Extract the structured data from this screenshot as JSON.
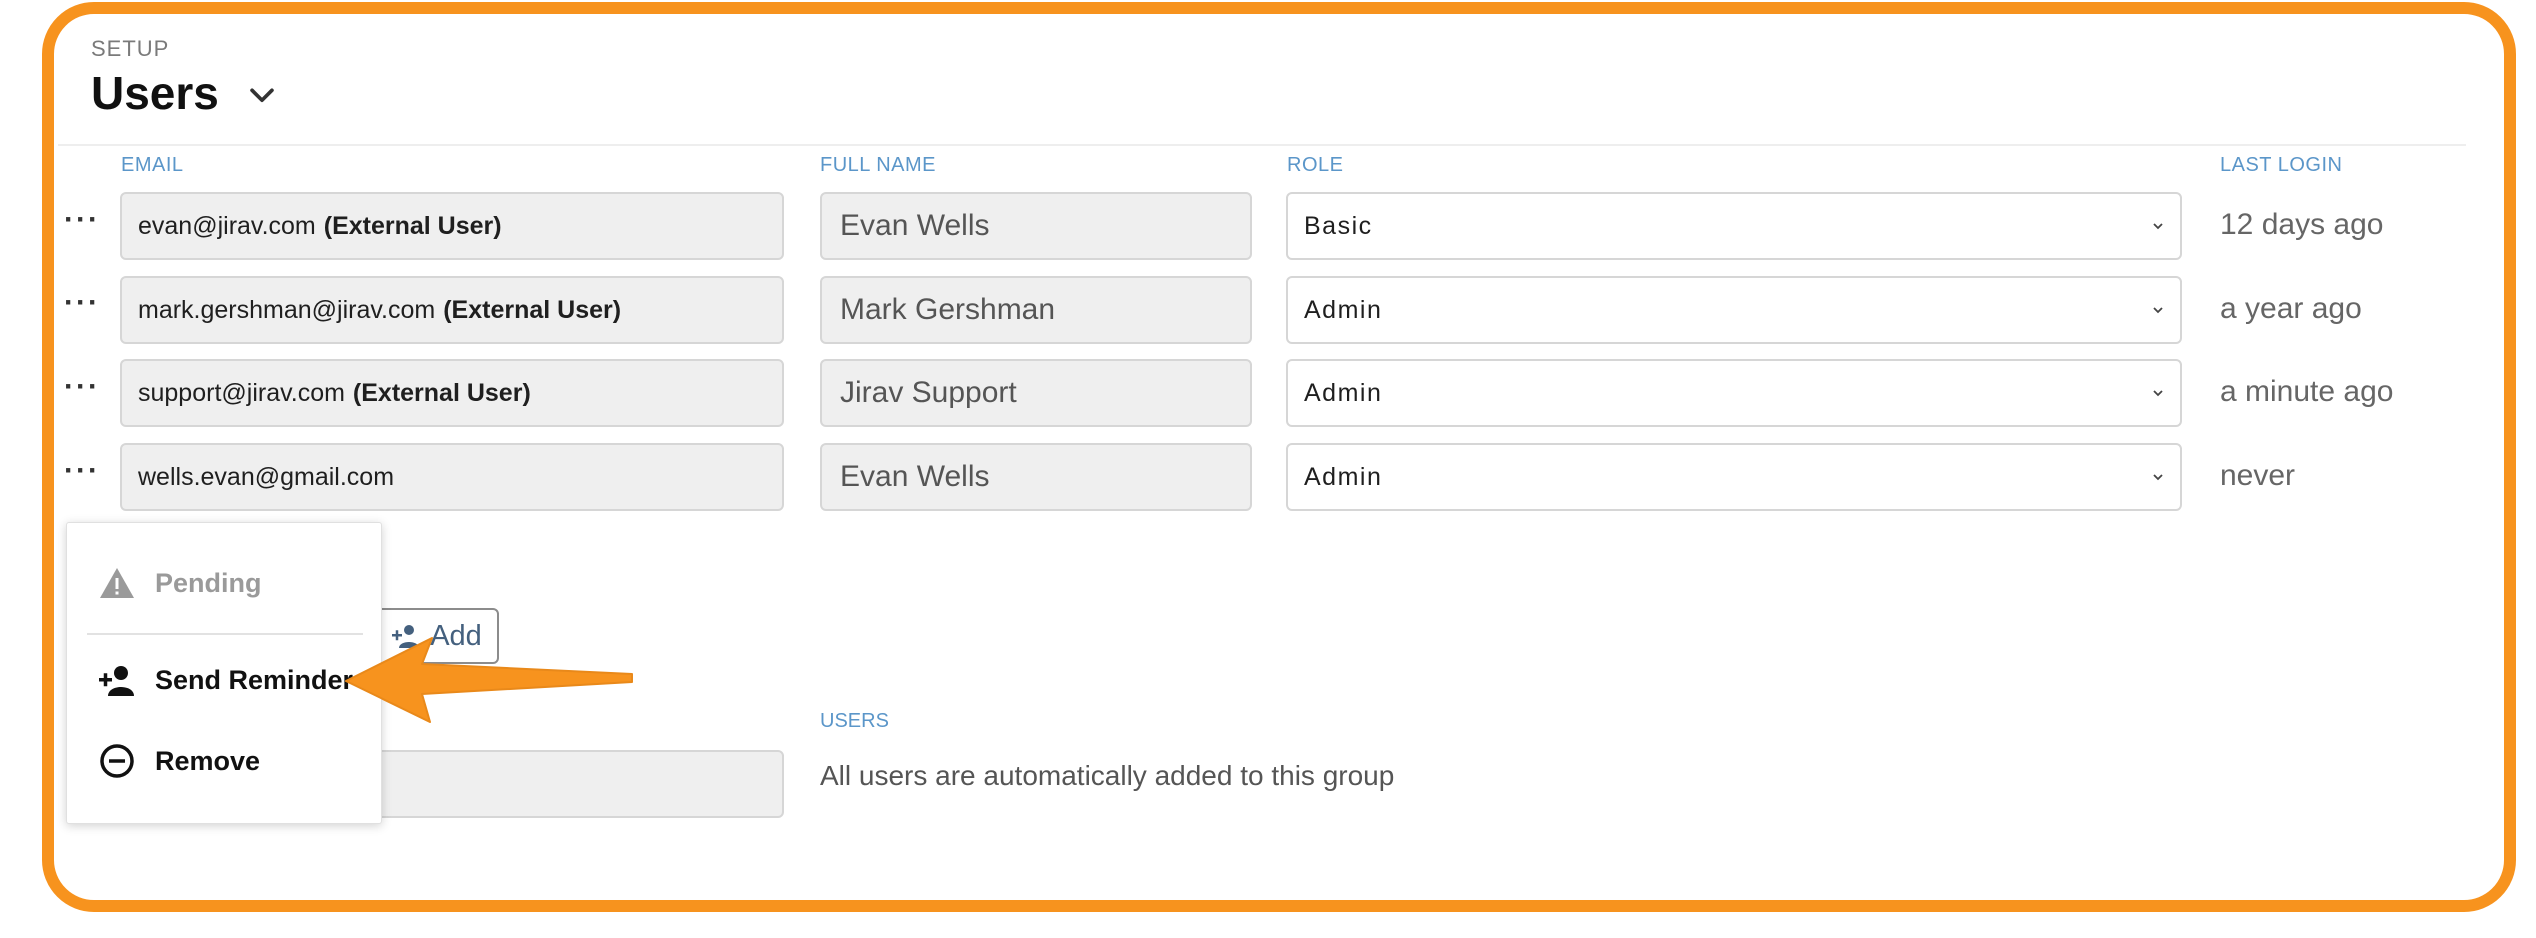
{
  "breadcrumb": "SETUP",
  "page_title": "Users",
  "columns": {
    "email": "EMAIL",
    "full_name": "FULL NAME",
    "role": "ROLE",
    "last_login": "LAST LOGIN"
  },
  "row_menu_glyph": "···",
  "users": [
    {
      "email": "evan@jirav.com",
      "tag": "(External User)",
      "full_name": "Evan Wells",
      "role": "Basic",
      "last_login": "12 days ago"
    },
    {
      "email": "mark.gershman@jirav.com",
      "tag": "(External User)",
      "full_name": "Mark Gershman",
      "role": "Admin",
      "last_login": "a year ago"
    },
    {
      "email": "support@jirav.com",
      "tag": "(External User)",
      "full_name": "Jirav Support",
      "role": "Admin",
      "last_login": "a minute ago"
    },
    {
      "email": "wells.evan@gmail.com",
      "tag": "",
      "full_name": "Evan Wells",
      "role": "Admin",
      "last_login": "never"
    }
  ],
  "add_button_label": "Add",
  "groups": {
    "users_header": "USERS",
    "note": "All users are automatically added to this group"
  },
  "context_menu": {
    "status": "Pending",
    "send_reminder": "Send Reminder",
    "remove": "Remove"
  },
  "colors": {
    "frame": "#F7931E",
    "arrow": "#F7931E",
    "header_blue": "#5b96c9"
  },
  "icons": {
    "title": "chevron-down-icon",
    "select": "chevron-down-icon",
    "add": "add-user-icon",
    "pending": "warning-icon",
    "reminder": "add-user-icon",
    "remove": "minus-circle-icon"
  }
}
